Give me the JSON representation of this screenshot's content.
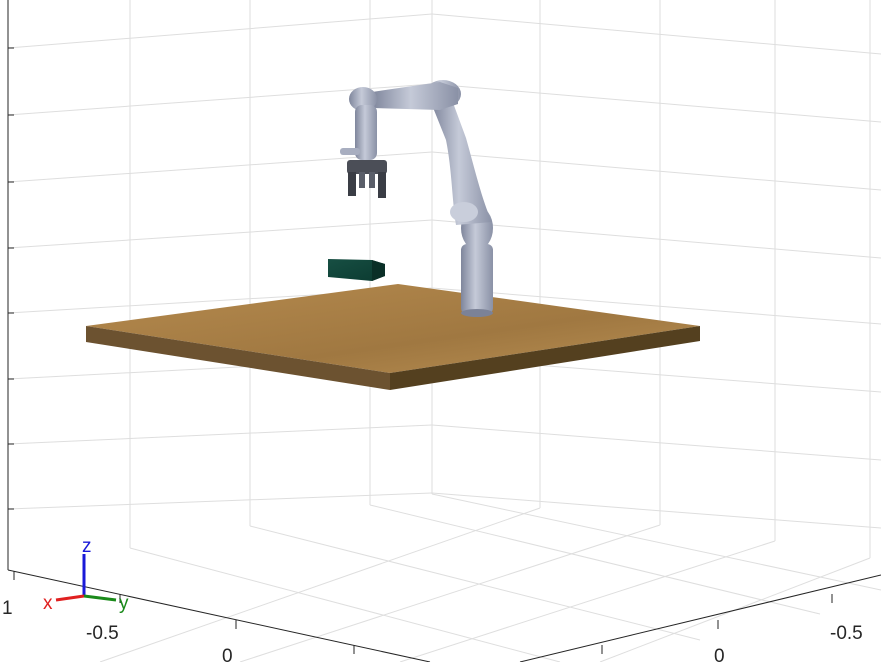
{
  "scene": {
    "title": "",
    "tick_labels": {
      "left_axis": [
        "1",
        "-0.5",
        "0"
      ],
      "right_axis": [
        "0",
        "-0.5"
      ]
    },
    "triad": {
      "x_label": "x",
      "y_label": "y",
      "z_label": "z",
      "x_color": "#e02020",
      "y_color": "#1a8a1a",
      "z_color": "#1a1ad8"
    },
    "colors": {
      "table_top": "#a97f45",
      "table_front": "#6e5430",
      "table_side": "#5a4426",
      "box": "#10453a",
      "robot_link": "#9aa1b8",
      "robot_joint": "#c3c8d6",
      "gripper": "#4a4d55"
    },
    "objects": {
      "table": "table",
      "box": "box",
      "robot": "robot-arm",
      "gripper": "gripper"
    }
  }
}
